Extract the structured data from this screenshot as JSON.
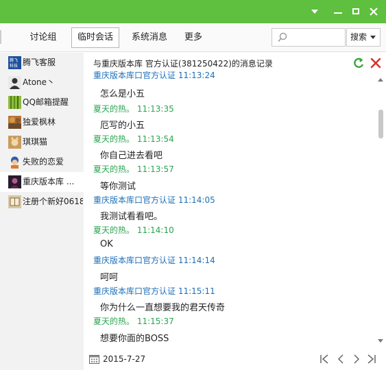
{
  "toolbar": {
    "tabs": [
      "讨论组",
      "临时会话",
      "系统消息",
      "更多"
    ],
    "search_placeholder": "",
    "search_button": "搜索"
  },
  "contacts": [
    {
      "name": "腾飞客服",
      "icon": "tengfei-logo-avatar"
    },
    {
      "name": "Atone丶",
      "icon": "person-avatar"
    },
    {
      "name": "QQ邮箱提醒",
      "icon": "bamboo-avatar"
    },
    {
      "name": "独爱枫林",
      "icon": "autumn-forest-avatar"
    },
    {
      "name": "琪琪猫",
      "icon": "cat-avatar"
    },
    {
      "name": "失败的恋爱",
      "icon": "cartoon-avatar"
    },
    {
      "name": "重庆版本库 ...",
      "icon": "dark-avatar"
    },
    {
      "name": "注册个新好0618",
      "icon": "book-avatar"
    }
  ],
  "header": {
    "title": "与重庆版本库  官方认证(381250422)的消息记录"
  },
  "messages": [
    {
      "sender": "重庆版本库口官方认证",
      "time": "11:13:24",
      "color": "blue",
      "text": "怎么是小五"
    },
    {
      "sender": "夏天的热。",
      "time": "11:13:35",
      "color": "green",
      "text": "厄写的小五"
    },
    {
      "sender": "夏天的热。",
      "time": "11:13:54",
      "color": "green",
      "text": "你自己进去看吧"
    },
    {
      "sender": "夏天的热。",
      "time": "11:13:57",
      "color": "green",
      "text": "等你测试"
    },
    {
      "sender": "重庆版本库口官方认证",
      "time": "11:14:05",
      "color": "blue",
      "text": "我测试看看吧。"
    },
    {
      "sender": "夏天的热。",
      "time": "11:14:10",
      "color": "green",
      "text": "OK"
    },
    {
      "sender": "重庆版本库口官方认证",
      "time": "11:14:14",
      "color": "blue",
      "text": "呵呵"
    },
    {
      "sender": "重庆版本库口官方认证",
      "time": "11:15:11",
      "color": "blue",
      "text": "你为什么一直想要我的君天传奇"
    },
    {
      "sender": "夏天的热。",
      "time": "11:15:37",
      "color": "green",
      "text": "想要你面的BOSS"
    }
  ],
  "footer": {
    "date": "2015-7-27"
  },
  "colors": {
    "titlebar": "#5fbf3e",
    "sender_blue": "#1e6fb8",
    "sender_green": "#2aa44f"
  }
}
